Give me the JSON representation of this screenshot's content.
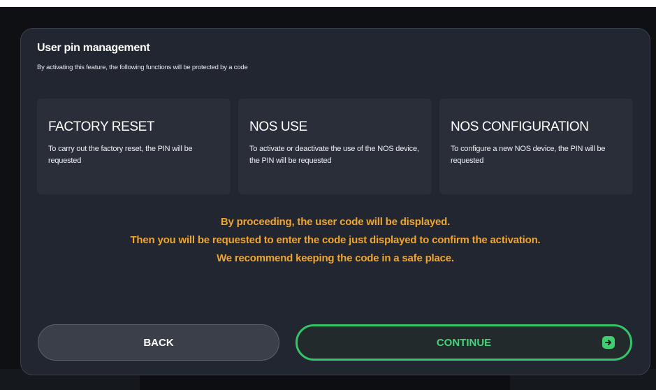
{
  "dialog": {
    "title": "User pin management",
    "subtitle": "By activating this feature, the following functions will be protected by a code"
  },
  "features": [
    {
      "title": "FACTORY RESET",
      "description": "To carry out the factory reset, the PIN will be requested"
    },
    {
      "title": "NOS USE",
      "description": "To activate or deactivate the use of the NOS device, the PIN will be requested"
    },
    {
      "title": "NOS CONFIGURATION",
      "description": "To configure a new NOS device, the PIN will be requested"
    }
  ],
  "notice": {
    "line1": "By proceeding, the user code will be displayed.",
    "line2": "Then you will be requested to enter the code just displayed to confirm the activation.",
    "line3": "We recommend keeping the code in a safe place."
  },
  "buttons": {
    "back_label": "BACK",
    "continue_label": "CONTINUE",
    "continue_icon": "arrow-right-circle-icon"
  },
  "colors": {
    "notice": "#f0a531",
    "accent_green": "#35c46a",
    "dialog_bg": "#222630",
    "card_bg": "#2a2e38"
  }
}
